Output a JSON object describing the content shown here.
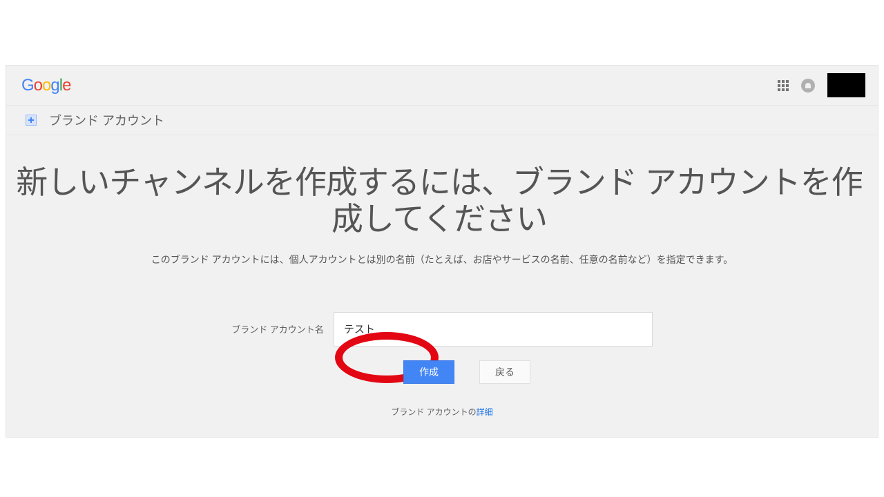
{
  "logo_chars": [
    "G",
    "o",
    "o",
    "g",
    "l",
    "e"
  ],
  "subheader": {
    "title": "ブランド アカウント"
  },
  "main": {
    "heading": "新しいチャンネルを作成するには、ブランド アカウントを作成してください",
    "description": "このブランド アカウントには、個人アカウントとは別の名前（たとえば、お店やサービスの名前、任意の名前など）を指定できます。",
    "form_label": "ブランド アカウント名",
    "input_value": "テスト",
    "create_label": "作成",
    "back_label": "戻る",
    "footnote_prefix": "ブランド アカウントの",
    "footnote_link": "詳細"
  }
}
